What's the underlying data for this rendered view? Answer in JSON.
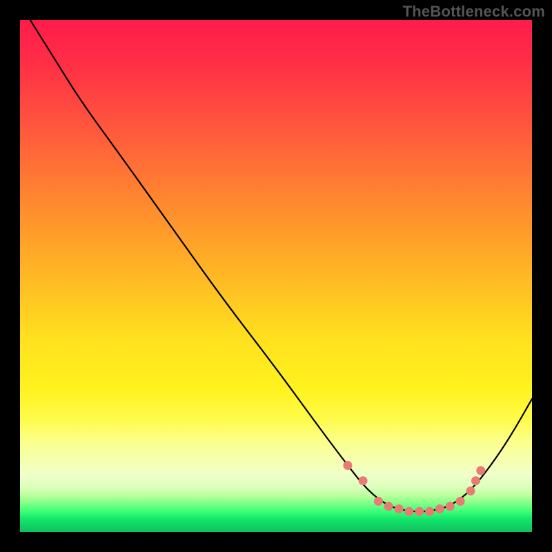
{
  "watermark": "TheBottleneck.com",
  "chart_data": {
    "type": "line",
    "title": "",
    "xlabel": "",
    "ylabel": "",
    "xlim": [
      0,
      100
    ],
    "ylim": [
      0,
      100
    ],
    "grid": false,
    "legend": false,
    "curve": [
      {
        "x": 2,
        "y": 100
      },
      {
        "x": 7,
        "y": 92
      },
      {
        "x": 12,
        "y": 84
      },
      {
        "x": 20,
        "y": 73
      },
      {
        "x": 30,
        "y": 59
      },
      {
        "x": 40,
        "y": 45
      },
      {
        "x": 50,
        "y": 32
      },
      {
        "x": 58,
        "y": 21
      },
      {
        "x": 64,
        "y": 13
      },
      {
        "x": 68,
        "y": 8
      },
      {
        "x": 72,
        "y": 5
      },
      {
        "x": 76,
        "y": 4
      },
      {
        "x": 80,
        "y": 4
      },
      {
        "x": 84,
        "y": 5
      },
      {
        "x": 88,
        "y": 8
      },
      {
        "x": 92,
        "y": 13
      },
      {
        "x": 96,
        "y": 19
      },
      {
        "x": 100,
        "y": 26
      }
    ],
    "highlight_points": [
      {
        "x": 64,
        "y": 13
      },
      {
        "x": 67,
        "y": 10
      },
      {
        "x": 70,
        "y": 6
      },
      {
        "x": 72,
        "y": 5
      },
      {
        "x": 74,
        "y": 4.5
      },
      {
        "x": 76,
        "y": 4
      },
      {
        "x": 78,
        "y": 4
      },
      {
        "x": 80,
        "y": 4
      },
      {
        "x": 82,
        "y": 4.5
      },
      {
        "x": 84,
        "y": 5
      },
      {
        "x": 86,
        "y": 6
      },
      {
        "x": 88,
        "y": 8
      },
      {
        "x": 89,
        "y": 10
      },
      {
        "x": 90,
        "y": 12
      }
    ],
    "gradient_stops": [
      {
        "pos": 0,
        "color": "#ff1c4a"
      },
      {
        "pos": 36,
        "color": "#ff8a2e"
      },
      {
        "pos": 62,
        "color": "#ffe01e"
      },
      {
        "pos": 86,
        "color": "#eeffca"
      },
      {
        "pos": 96,
        "color": "#3bff78"
      },
      {
        "pos": 100,
        "color": "#0fbf5e"
      }
    ]
  }
}
